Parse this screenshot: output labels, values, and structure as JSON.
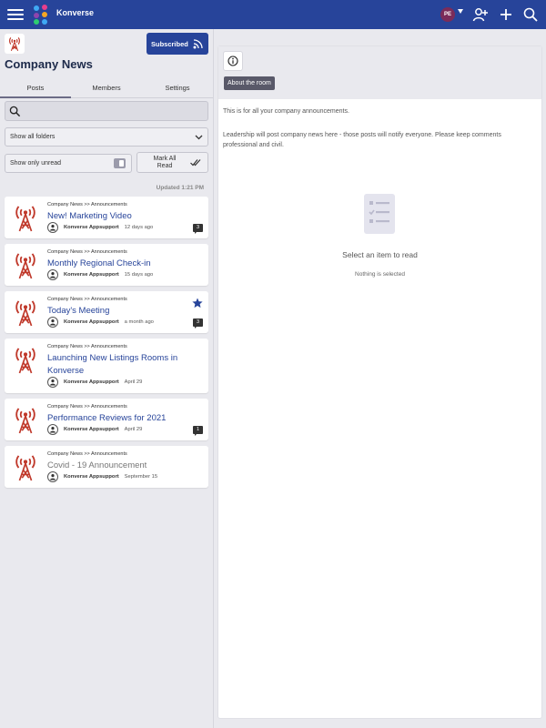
{
  "app": {
    "title": "Konverse",
    "user_initials": "PE",
    "brand_color": "#27449a"
  },
  "room": {
    "title": "Company News",
    "subscribe_label": "Subscribed",
    "tabs": [
      {
        "label": "Posts",
        "active": true
      },
      {
        "label": "Members",
        "active": false
      },
      {
        "label": "Settings",
        "active": false
      }
    ]
  },
  "filters": {
    "search_placeholder": "",
    "folder_select": "Show all folders",
    "unread_label": "Show only unread",
    "mark_all_read": "Mark All Read"
  },
  "updated_text": "Updated 1:21 PM",
  "posts": [
    {
      "path": "Company News >> Announcements",
      "title": "New! Marketing Video",
      "author": "Konverse Appsupport",
      "time": "12 days ago",
      "count": "3",
      "starred": false,
      "read": false
    },
    {
      "path": "Company News >> Announcements",
      "title": "Monthly Regional Check-in",
      "author": "Konverse Appsupport",
      "time": "15 days ago",
      "count": "",
      "starred": false,
      "read": false
    },
    {
      "path": "Company News >> Announcements",
      "title": "Today's Meeting",
      "author": "Konverse Appsupport",
      "time": "a month ago",
      "count": "3",
      "starred": true,
      "read": false
    },
    {
      "path": "Company News >> Announcements",
      "title": "Launching New Listings Rooms in Konverse",
      "author": "Konverse Appsupport",
      "time": "April 29",
      "count": "",
      "starred": false,
      "read": false
    },
    {
      "path": "Company News >> Announcements",
      "title": "Performance Reviews for 2021",
      "author": "Konverse Appsupport",
      "time": "April 29",
      "count": "1",
      "starred": false,
      "read": false
    },
    {
      "path": "Company News >> Announcements",
      "title": "Covid - 19 Announcement",
      "author": "Konverse Appsupport",
      "time": "September 15",
      "count": "",
      "starred": false,
      "read": true
    }
  ],
  "about": {
    "tab_label": "About the room",
    "line1": "This is for all your company announcements.",
    "line2": "Leadership will post company news here - those posts will notify everyone. Please keep comments professional and civil."
  },
  "empty_state": {
    "title": "Select an item to read",
    "subtitle": "Nothing is selected"
  },
  "icons": {
    "menu": "hamburger-icon",
    "add_user": "add-user-icon",
    "add": "plus-icon",
    "search": "search-icon",
    "rss": "rss-icon",
    "info": "info-icon",
    "tower": "broadcast-tower-icon",
    "star": "star-icon"
  }
}
